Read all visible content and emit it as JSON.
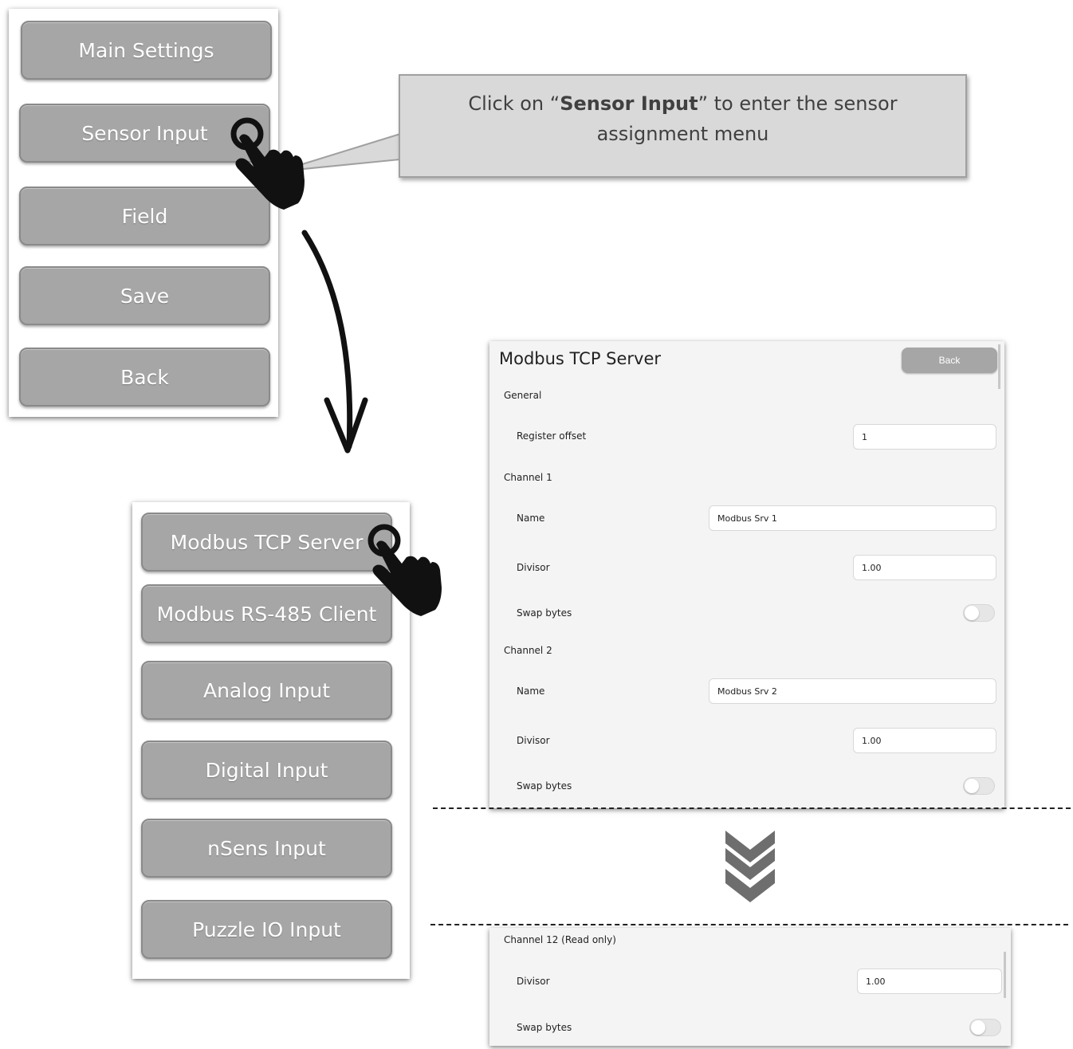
{
  "main_menu": {
    "buttons": [
      "Main Settings",
      "Sensor Input",
      "Field",
      "Save",
      "Back"
    ]
  },
  "callout": {
    "prefix": "Click on “",
    "bold": "Sensor Input",
    "suffix": "” to enter the sensor assignment menu"
  },
  "sensor_menu": {
    "buttons": [
      "Modbus TCP Server",
      "Modbus RS-485 Client",
      "Analog Input",
      "Digital Input",
      "nSens Input",
      "Puzzle IO Input"
    ]
  },
  "modbus": {
    "title": "Modbus TCP Server",
    "back_label": "Back",
    "general_label": "General",
    "register_offset_label": "Register offset",
    "register_offset_value": "1",
    "channel1": {
      "label": "Channel 1",
      "name_label": "Name",
      "name_value": "Modbus Srv 1",
      "divisor_label": "Divisor",
      "divisor_value": "1.00",
      "swap_label": "Swap bytes"
    },
    "channel2": {
      "label": "Channel 2",
      "name_label": "Name",
      "name_value": "Modbus Srv 2",
      "divisor_label": "Divisor",
      "divisor_value": "1.00",
      "swap_label": "Swap bytes"
    }
  },
  "modbus_bottom": {
    "channel12_label": "Channel 12 (Read only)",
    "divisor_label": "Divisor",
    "divisor_value": "1.00",
    "swap_label": "Swap bytes"
  },
  "colors": {
    "button_gray": "#a6a6a6",
    "callout_bg": "#d9d9d9",
    "panel_bg": "#f4f4f4",
    "chevron": "#6e6e6e"
  },
  "icons": [
    "pointing-hand-icon",
    "curved-arrow-icon",
    "double-chevron-down-icon"
  ]
}
